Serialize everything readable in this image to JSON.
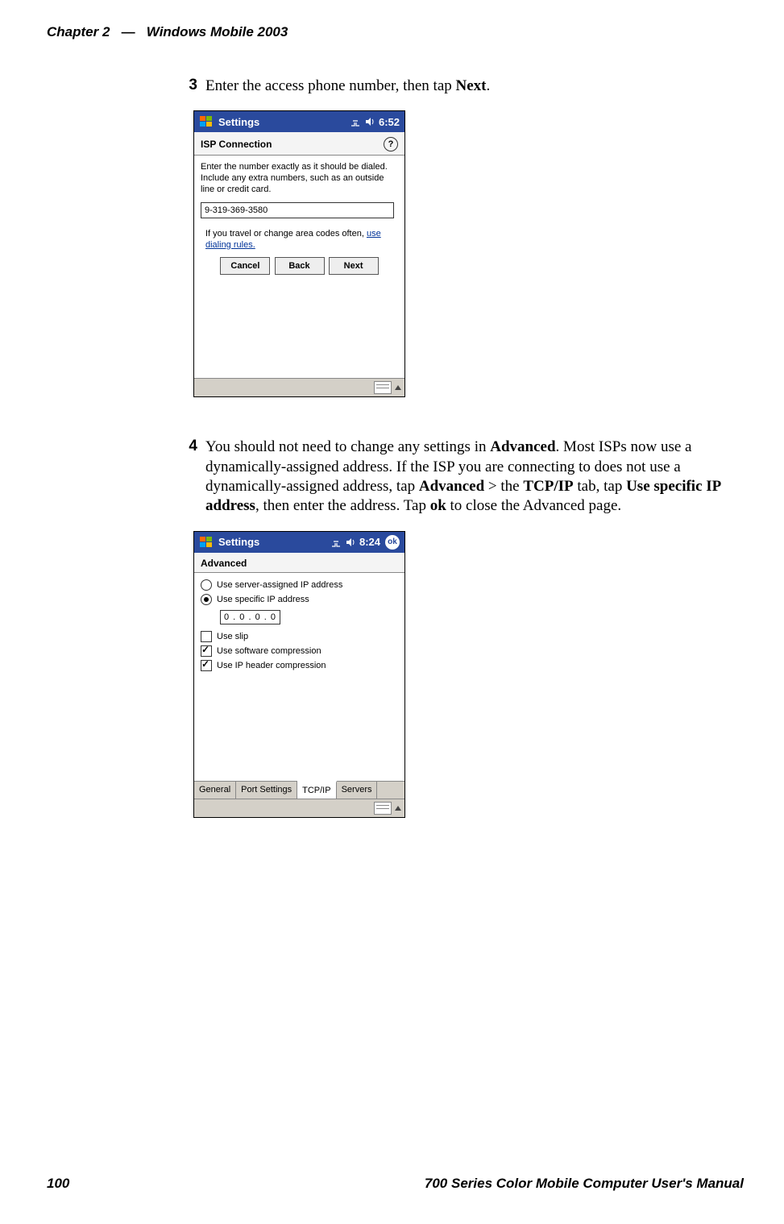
{
  "header": {
    "chapter": "Chapter 2",
    "dash": "—",
    "title": "Windows Mobile 2003"
  },
  "footer": {
    "page": "100",
    "manual": "700 Series Color Mobile Computer User's Manual"
  },
  "step3": {
    "num": "3",
    "text_a": "Enter the access phone number, then tap ",
    "bold": "Next",
    "text_b": "."
  },
  "step4": {
    "num": "4",
    "t0": "You should not need to change any settings in ",
    "b0": "Advanced",
    "t1": ". Most ISPs now use a dynamically-assigned address. If the ISP you are connecting to does not use a dynamically-assigned address, tap ",
    "b1": "Advanced",
    "t2": " > the ",
    "b2": "TCP/IP",
    "t3": " tab, tap ",
    "b3": "Use specific IP address",
    "t4": ", then enter the address. Tap ",
    "b4": "ok",
    "t5": " to close the Advanced page."
  },
  "device1": {
    "titlebar": {
      "title": "Settings",
      "time": "6:52"
    },
    "section": "ISP Connection",
    "help": "?",
    "instruction": "Enter the number exactly as it should be dialed.  Include any extra numbers, such as an outside line or credit card.",
    "phone": "9-319-369-3580",
    "hint_a": "If you travel or change area codes often, ",
    "hint_link": "use dialing rules.",
    "buttons": {
      "cancel": "Cancel",
      "back": "Back",
      "next": "Next"
    }
  },
  "device2": {
    "titlebar": {
      "title": "Settings",
      "time": "8:24",
      "ok": "ok"
    },
    "section": "Advanced",
    "radio1": "Use server-assigned IP address",
    "radio2": "Use specific IP address",
    "ip": "0   .   0   .   0   .   0",
    "chk1": "Use slip",
    "chk2": "Use software compression",
    "chk3": "Use IP header compression",
    "tabs": {
      "general": "General",
      "port": "Port Settings",
      "tcpip": "TCP/IP",
      "servers": "Servers"
    }
  }
}
